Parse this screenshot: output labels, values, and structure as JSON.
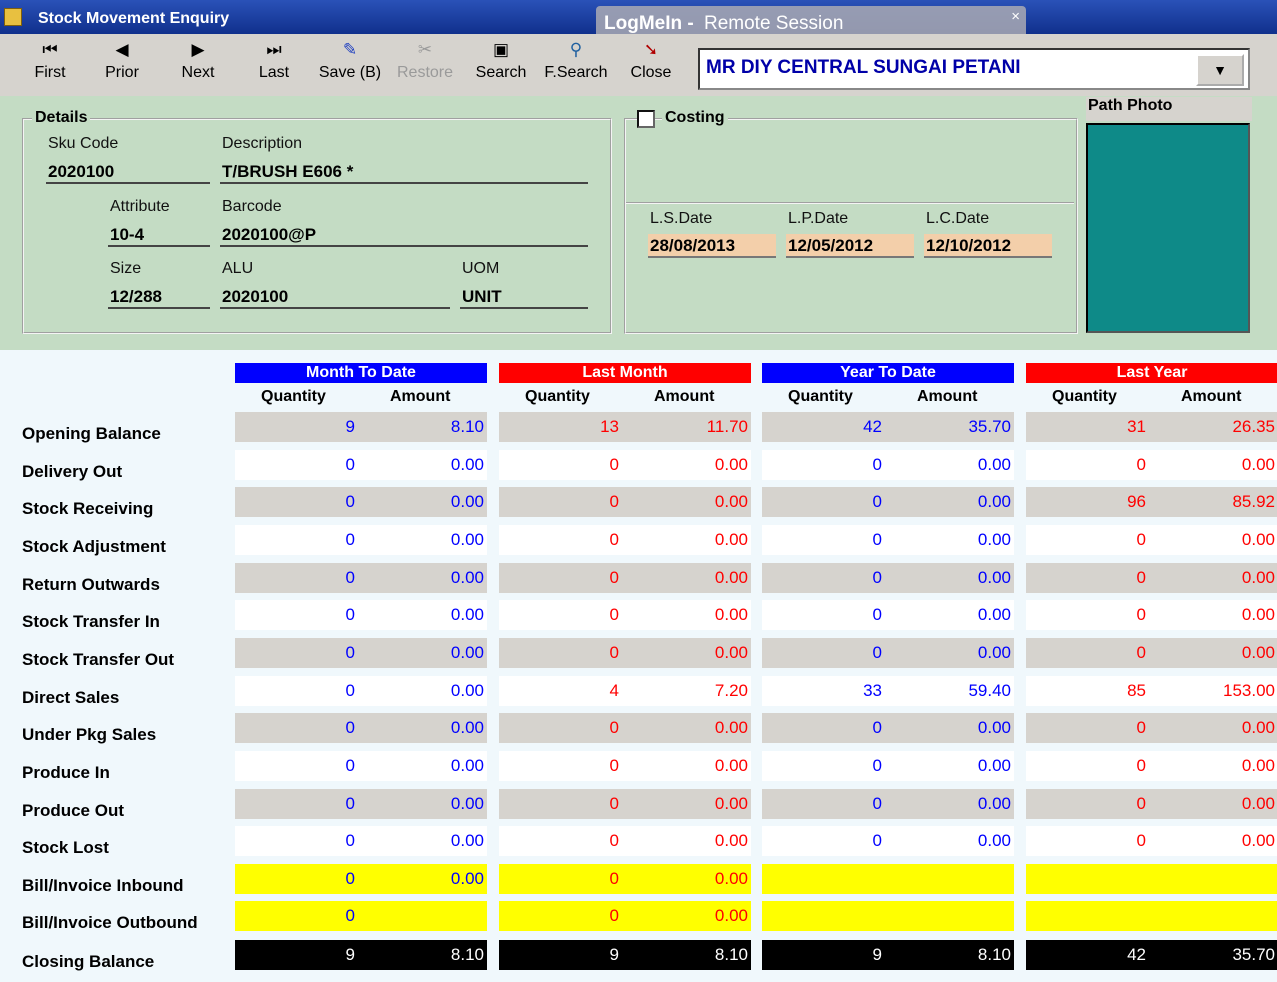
{
  "window": {
    "title": "Stock Movement Enquiry"
  },
  "remote_overlay": {
    "brand": "LogMeIn -",
    "label": "Remote Session",
    "close": "×"
  },
  "toolbar": {
    "buttons": [
      {
        "label": "First",
        "icon": "first-icon"
      },
      {
        "label": "Prior",
        "icon": "prior-icon"
      },
      {
        "label": "Next",
        "icon": "next-icon"
      },
      {
        "label": "Last",
        "icon": "last-icon"
      },
      {
        "label": "Save (B)",
        "icon": "save-icon"
      },
      {
        "label": "Restore",
        "icon": "restore-icon"
      },
      {
        "label": "Search",
        "icon": "search-icon"
      },
      {
        "label": "F.Search",
        "icon": "fsearch-icon"
      },
      {
        "label": "Close",
        "icon": "close-icon"
      }
    ]
  },
  "store_select": {
    "value": "MR DIY CENTRAL SUNGAI PETANI"
  },
  "details": {
    "title": "Details",
    "sku_label": "Sku Code",
    "sku": "2020100",
    "desc_label": "Description",
    "desc": "T/BRUSH E606 *",
    "attr_label": "Attribute",
    "attr": "10-4",
    "barcode_label": "Barcode",
    "barcode": "2020100@P",
    "size_label": "Size",
    "size": "12/288",
    "alu_label": "ALU",
    "alu": "2020100",
    "uom_label": "UOM",
    "uom": "UNIT"
  },
  "costing": {
    "title": "Costing",
    "ls_label": "L.S.Date",
    "ls": "28/08/2013",
    "lp_label": "L.P.Date",
    "lp": "12/05/2012",
    "lc_label": "L.C.Date",
    "lc": "12/10/2012"
  },
  "photo": {
    "label": "Path Photo"
  },
  "table": {
    "groups": [
      {
        "title": "Month To Date",
        "color": "#0000ff"
      },
      {
        "title": "Last Month",
        "color": "#ff0000"
      },
      {
        "title": "Year To Date",
        "color": "#0000ff"
      },
      {
        "title": "Last Year",
        "color": "#ff0000"
      }
    ],
    "qty_label": "Quantity",
    "amt_label": "Amount",
    "rows": [
      {
        "label": "Opening Balance",
        "v": [
          "9",
          "8.10",
          "13",
          "11.70",
          "42",
          "35.70",
          "31",
          "26.35"
        ]
      },
      {
        "label": "Delivery Out",
        "v": [
          "0",
          "0.00",
          "0",
          "0.00",
          "0",
          "0.00",
          "0",
          "0.00"
        ]
      },
      {
        "label": "Stock Receiving",
        "v": [
          "0",
          "0.00",
          "0",
          "0.00",
          "0",
          "0.00",
          "96",
          "85.92"
        ]
      },
      {
        "label": "Stock Adjustment",
        "v": [
          "0",
          "0.00",
          "0",
          "0.00",
          "0",
          "0.00",
          "0",
          "0.00"
        ]
      },
      {
        "label": "Return Outwards",
        "v": [
          "0",
          "0.00",
          "0",
          "0.00",
          "0",
          "0.00",
          "0",
          "0.00"
        ]
      },
      {
        "label": "Stock Transfer In",
        "v": [
          "0",
          "0.00",
          "0",
          "0.00",
          "0",
          "0.00",
          "0",
          "0.00"
        ]
      },
      {
        "label": "Stock Transfer Out",
        "v": [
          "0",
          "0.00",
          "0",
          "0.00",
          "0",
          "0.00",
          "0",
          "0.00"
        ]
      },
      {
        "label": "Direct Sales",
        "v": [
          "0",
          "0.00",
          "4",
          "7.20",
          "33",
          "59.40",
          "85",
          "153.00"
        ]
      },
      {
        "label": "Under Pkg Sales",
        "v": [
          "0",
          "0.00",
          "0",
          "0.00",
          "0",
          "0.00",
          "0",
          "0.00"
        ]
      },
      {
        "label": "Produce In",
        "v": [
          "0",
          "0.00",
          "0",
          "0.00",
          "0",
          "0.00",
          "0",
          "0.00"
        ]
      },
      {
        "label": "Produce Out",
        "v": [
          "0",
          "0.00",
          "0",
          "0.00",
          "0",
          "0.00",
          "0",
          "0.00"
        ]
      },
      {
        "label": "Stock Lost",
        "v": [
          "0",
          "0.00",
          "0",
          "0.00",
          "0",
          "0.00",
          "0",
          "0.00"
        ]
      },
      {
        "label": "Bill/Invoice Inbound",
        "v": [
          "0",
          "0.00",
          "0",
          "0.00",
          "",
          "",
          "",
          ""
        ]
      },
      {
        "label": "Bill/Invoice Outbound",
        "v": [
          "0",
          "",
          "0",
          "0.00",
          "",
          "",
          "",
          ""
        ]
      }
    ],
    "closing": {
      "label": "Closing Balance",
      "v": [
        "9",
        "8.10",
        "9",
        "8.10",
        "9",
        "8.10",
        "42",
        "35.70"
      ]
    }
  }
}
